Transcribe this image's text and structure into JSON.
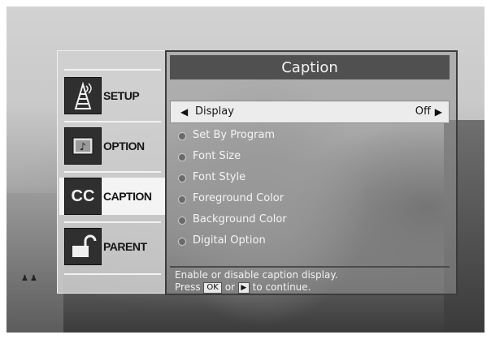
{
  "sidebar": {
    "items": [
      {
        "label": "SETUP",
        "icon": "tower-icon"
      },
      {
        "label": "OPTION",
        "icon": "music-note-icon"
      },
      {
        "label": "CAPTION",
        "icon": "cc-icon",
        "icon_text": "CC"
      },
      {
        "label": "PARENT",
        "icon": "unlock-icon"
      }
    ],
    "active": "CAPTION"
  },
  "panel": {
    "title": "Caption",
    "menu": [
      {
        "label": "Display",
        "value": "Off"
      },
      {
        "label": "Set By Program"
      },
      {
        "label": "Font Size"
      },
      {
        "label": "Font Style"
      },
      {
        "label": "Foreground Color"
      },
      {
        "label": "Background Color"
      },
      {
        "label": "Digital Option"
      }
    ],
    "help_line1": "Enable or disable caption display.",
    "help_press": "Press",
    "help_ok_key": "OK",
    "help_or": "or",
    "help_continue": "to continue."
  },
  "colors": {
    "accent": "#505050",
    "selected_bg": "#ececec"
  }
}
